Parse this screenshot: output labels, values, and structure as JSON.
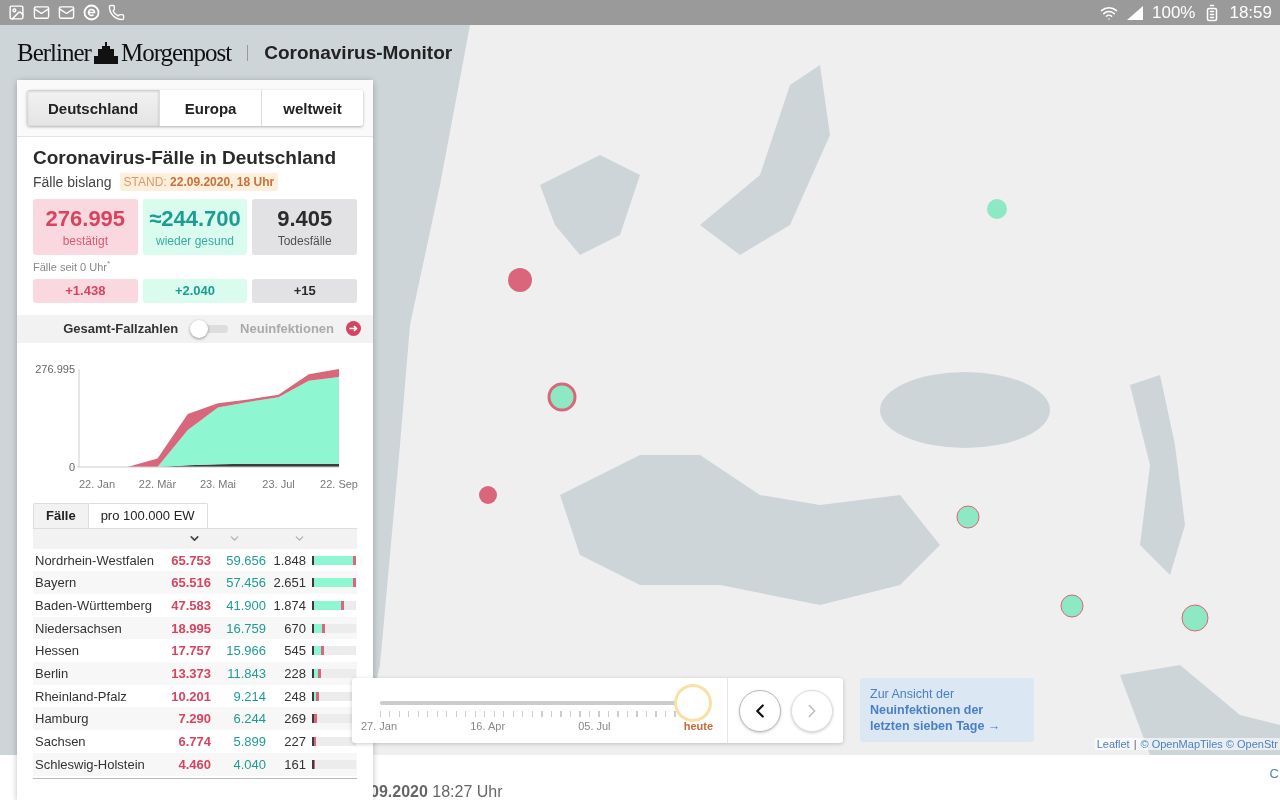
{
  "status_bar": {
    "battery": "100%",
    "time": "18:59"
  },
  "header": {
    "logo_left": "Berliner",
    "logo_right": "Morgenpost",
    "title": "Coronavirus-Monitor"
  },
  "region_tabs": [
    {
      "label": "Deutschland",
      "selected": true
    },
    {
      "label": "Europa",
      "selected": false
    },
    {
      "label": "weltweit",
      "selected": false
    }
  ],
  "summary": {
    "title": "Coronavirus-Fälle in Deutschland",
    "subtitle": "Fälle bislang",
    "stand": "STAND: **22.09.2020, 18 Uhr**",
    "totals": [
      {
        "kind": "confirmed",
        "value": "276.995",
        "label": "bestätigt"
      },
      {
        "kind": "recovered",
        "value": "≈244.700",
        "label": "wieder gesund"
      },
      {
        "kind": "deaths",
        "value": "9.405",
        "label": "Todesfälle"
      }
    ],
    "today_label": "Fälle seit 0 Uhr$^{*}$",
    "today": [
      {
        "kind": "confirmed",
        "value": "+1.438"
      },
      {
        "kind": "recovered",
        "value": "+2.040"
      },
      {
        "kind": "deaths",
        "value": "+15"
      }
    ]
  },
  "mode_toggle": {
    "left_label": "Gesamt-Fallzahlen",
    "right_label": "Neuinfektionen",
    "on": false
  },
  "chart_data": {
    "type": "area",
    "stacked": true,
    "categories": [
      "22. Jan",
      null,
      "22. Mär",
      null,
      "23. Mai",
      null,
      "23. Jul",
      null,
      "22. Sep"
    ],
    "series": [
      {
        "color": "#3a3a3f",
        "values": [
          0,
          0,
          0,
          5000,
          8000,
          9000,
          9000,
          9000,
          9400
        ]
      },
      {
        "color": "#8ef7d2",
        "values": [
          0,
          0,
          0,
          100000,
          160000,
          175000,
          188000,
          235000,
          244700
        ]
      },
      {
        "color": "#d9667b",
        "values": [
          0,
          0,
          24000,
          45000,
          12000,
          7000,
          7000,
          18000,
          22895
        ]
      }
    ],
    "ylim": [
      0,
      276995
    ],
    "yticks": [
      0,
      {
        "value": 276995,
        "label": "276.995"
      }
    ]
  },
  "table_tabs": [
    {
      "label": "Fälle",
      "selected": true
    },
    {
      "label": "pro 100.000 EW",
      "selected": false
    }
  ],
  "sort_columns": [
    {
      "selected": true
    },
    {
      "selected": false
    },
    {
      "selected": false
    }
  ],
  "table": {
    "rows": [
      {
        "state": "Nordrhein-Westfalen",
        "confirmed": "65.753",
        "recovered": "59.656",
        "deaths": "1.848",
        "level": 1
      },
      {
        "state": "Bayern",
        "confirmed": "65.516",
        "recovered": "57.456",
        "deaths": "2.651",
        "level": 0.996
      },
      {
        "state": "Baden-Württemberg",
        "confirmed": "47.583",
        "recovered": "41.900",
        "deaths": "1.874",
        "level": 0.72
      },
      {
        "state": "Niedersachsen",
        "confirmed": "18.995",
        "recovered": "16.759",
        "deaths": "670",
        "level": 0.29
      },
      {
        "state": "Hessen",
        "confirmed": "17.757",
        "recovered": "15.966",
        "deaths": "545",
        "level": 0.27
      },
      {
        "state": "Berlin",
        "confirmed": "13.373",
        "recovered": "11.843",
        "deaths": "228",
        "level": 0.2
      },
      {
        "state": "Rheinland-Pfalz",
        "confirmed": "10.201",
        "recovered": "9.214",
        "deaths": "248",
        "level": 0.155
      },
      {
        "state": "Hamburg",
        "confirmed": "7.290",
        "recovered": "6.244",
        "deaths": "269",
        "level": 0.11
      },
      {
        "state": "Sachsen",
        "confirmed": "6.774",
        "recovered": "5.899",
        "deaths": "227",
        "level": 0.1
      },
      {
        "state": "Schleswig-Holstein",
        "confirmed": "4.460",
        "recovered": "4.040",
        "deaths": "161",
        "level": 0.068
      }
    ]
  },
  "timeline": {
    "level": 1,
    "labels": [
      {
        "text": "27. Jan",
        "current": false
      },
      {
        "text": "16. Apr",
        "current": false
      },
      {
        "text": "05. Jul",
        "current": false
      },
      {
        "text": "heute",
        "current": true
      }
    ],
    "prev_disabled": false,
    "next_disabled": true
  },
  "cta": "Zur Ansicht der **Neuinfektionen der letzten sieben Tage** →",
  "attribution": {
    "links": [
      "Leaflet",
      "© OpenMapTiles © OpenStr"
    ],
    "separator": "|"
  },
  "footer": {
    "timestamp": "**09.2020** 18:27 Uhr",
    "link": "C"
  }
}
